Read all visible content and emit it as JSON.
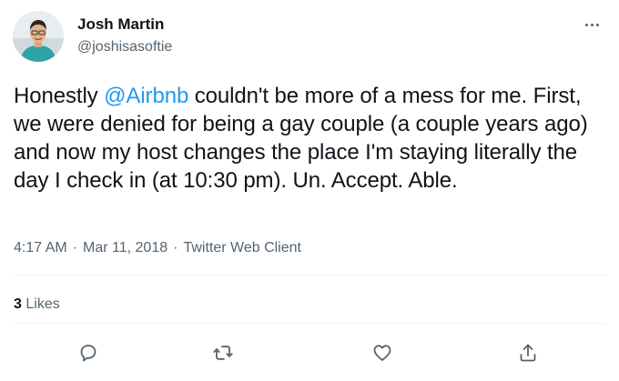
{
  "author": {
    "display_name": "Josh Martin",
    "handle": "@joshisasoftie",
    "avatar_icon": "profile-photo"
  },
  "tweet": {
    "text_before": "Honestly ",
    "mention": "@Airbnb",
    "text_after": " couldn't be more of a mess for me. First, we were denied for being a gay couple (a couple years ago) and now my host changes the place I'm staying literally the day I check in (at 10:30 pm). Un. Accept. Able."
  },
  "meta": {
    "time": "4:17 AM",
    "separator": "·",
    "date": "Mar 11, 2018",
    "client": "Twitter Web Client"
  },
  "stats": {
    "likes_count": "3",
    "likes_label": "Likes"
  },
  "actions": {
    "reply_icon": "reply-icon",
    "retweet_icon": "retweet-icon",
    "like_icon": "heart-icon",
    "share_icon": "share-icon"
  },
  "colors": {
    "text": "#0f1419",
    "secondary": "#536471",
    "accent": "#1d9bf0",
    "divider": "#eff3f4"
  }
}
